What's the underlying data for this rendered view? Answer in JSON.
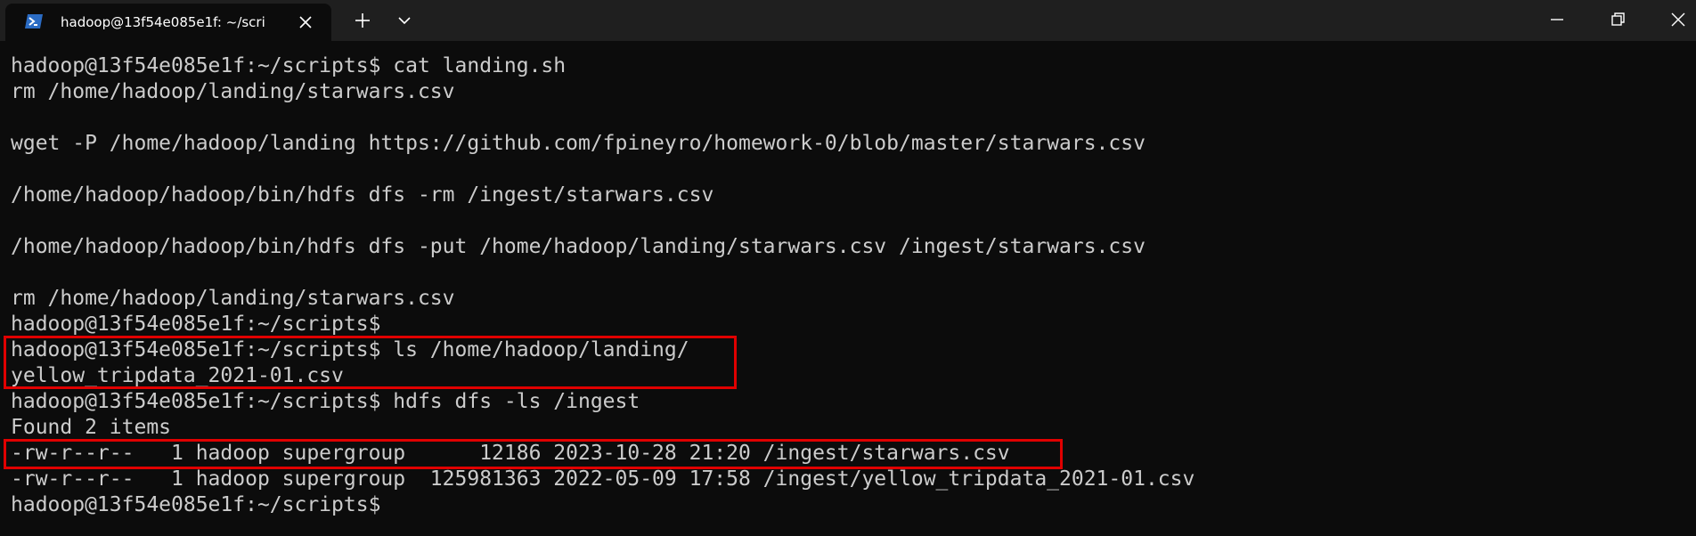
{
  "window": {
    "tab_title": "hadoop@13f54e085e1f: ~/scri",
    "tab_icon": "powershell-icon",
    "new_tab_icon": "plus-icon",
    "dropdown_icon": "chevron-down-icon",
    "close_tab_icon": "close-icon",
    "controls": [
      "minimize-icon",
      "maximize-icon",
      "close-icon"
    ]
  },
  "terminal": {
    "lines": [
      "hadoop@13f54e085e1f:~/scripts$ cat landing.sh",
      "rm /home/hadoop/landing/starwars.csv",
      "",
      "wget -P /home/hadoop/landing https://github.com/fpineyro/homework-0/blob/master/starwars.csv",
      "",
      "/home/hadoop/hadoop/bin/hdfs dfs -rm /ingest/starwars.csv",
      "",
      "/home/hadoop/hadoop/bin/hdfs dfs -put /home/hadoop/landing/starwars.csv /ingest/starwars.csv",
      "",
      "rm /home/hadoop/landing/starwars.csv",
      "hadoop@13f54e085e1f:~/scripts$",
      "hadoop@13f54e085e1f:~/scripts$ ls /home/hadoop/landing/",
      "yellow_tripdata_2021-01.csv",
      "hadoop@13f54e085e1f:~/scripts$ hdfs dfs -ls /ingest",
      "Found 2 items",
      "-rw-r--r--   1 hadoop supergroup      12186 2023-10-28 21:20 /ingest/starwars.csv",
      "-rw-r--r--   1 hadoop supergroup  125981363 2022-05-09 17:58 /ingest/yellow_tripdata_2021-01.csv",
      "hadoop@13f54e085e1f:~/scripts$"
    ]
  },
  "colors": {
    "background": "#0c0c0c",
    "titlebar": "#1f1f1f",
    "text": "#cccccc",
    "highlight_border": "#e00000"
  }
}
